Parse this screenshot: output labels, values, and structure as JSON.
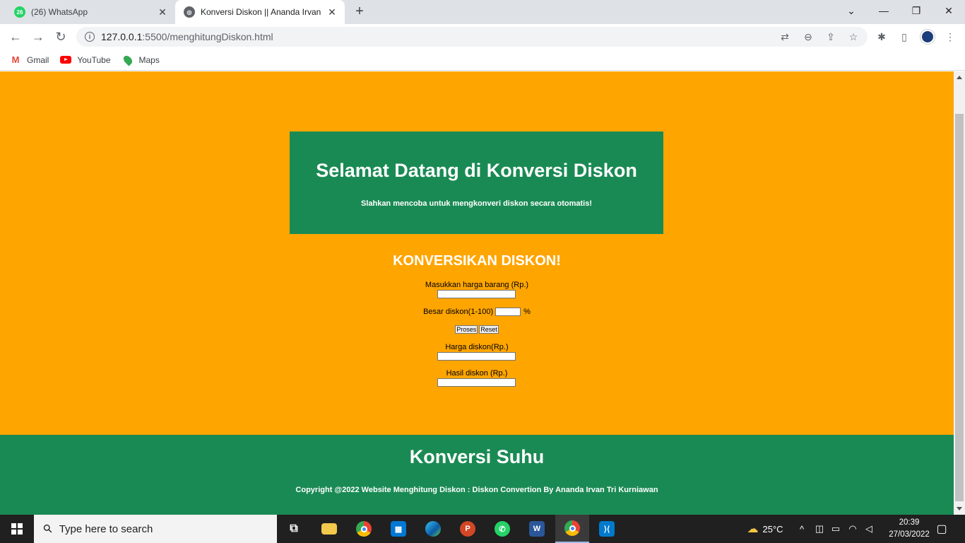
{
  "browser": {
    "tabs": [
      {
        "label": "(26) WhatsApp",
        "badge": "26"
      },
      {
        "label": "Konversi Diskon || Ananda Irvan"
      }
    ],
    "address": {
      "host": "127.0.0.1",
      "rest": ":5500/menghitungDiskon.html"
    },
    "bookmarks": [
      "Gmail",
      "YouTube",
      "Maps"
    ]
  },
  "page": {
    "hero": {
      "title": "Selamat Datang di Konversi Diskon",
      "subtitle": "Slahkan mencoba untuk mengkonveri diskon secara otomatis!"
    },
    "form": {
      "title": "KONVERSIKAN DISKON!",
      "harga_label": "Masukkan harga barang (Rp.)",
      "diskon_label": "Besar diskon(1-100)",
      "diskon_unit": "%",
      "proses_label": "Proses",
      "reset_label": "Reset",
      "harga_diskon_label": "Harga diskon(Rp.)",
      "hasil_label": "Hasil diskon (Rp.)",
      "harga_value": "",
      "diskon_value": "",
      "harga_diskon_value": "",
      "hasil_value": ""
    },
    "footer": {
      "title": "Konversi Suhu",
      "copyright": "Copyright @2022 Website Menghitung Diskon : Diskon Convertion By Ananda Irvan Tri Kurniawan"
    },
    "colors": {
      "orange": "#ffa500",
      "green": "#1a8a54"
    }
  },
  "taskbar": {
    "search_placeholder": "Type here to search",
    "weather": "25°C",
    "time": "20:39",
    "date": "27/03/2022",
    "apps": [
      "task-view-icon",
      "file-explorer-icon",
      "chrome-icon",
      "store-icon",
      "edge-icon",
      "powerpoint-icon",
      "whatsapp-icon",
      "word-icon",
      "chrome-active-icon",
      "vscode-icon"
    ]
  }
}
